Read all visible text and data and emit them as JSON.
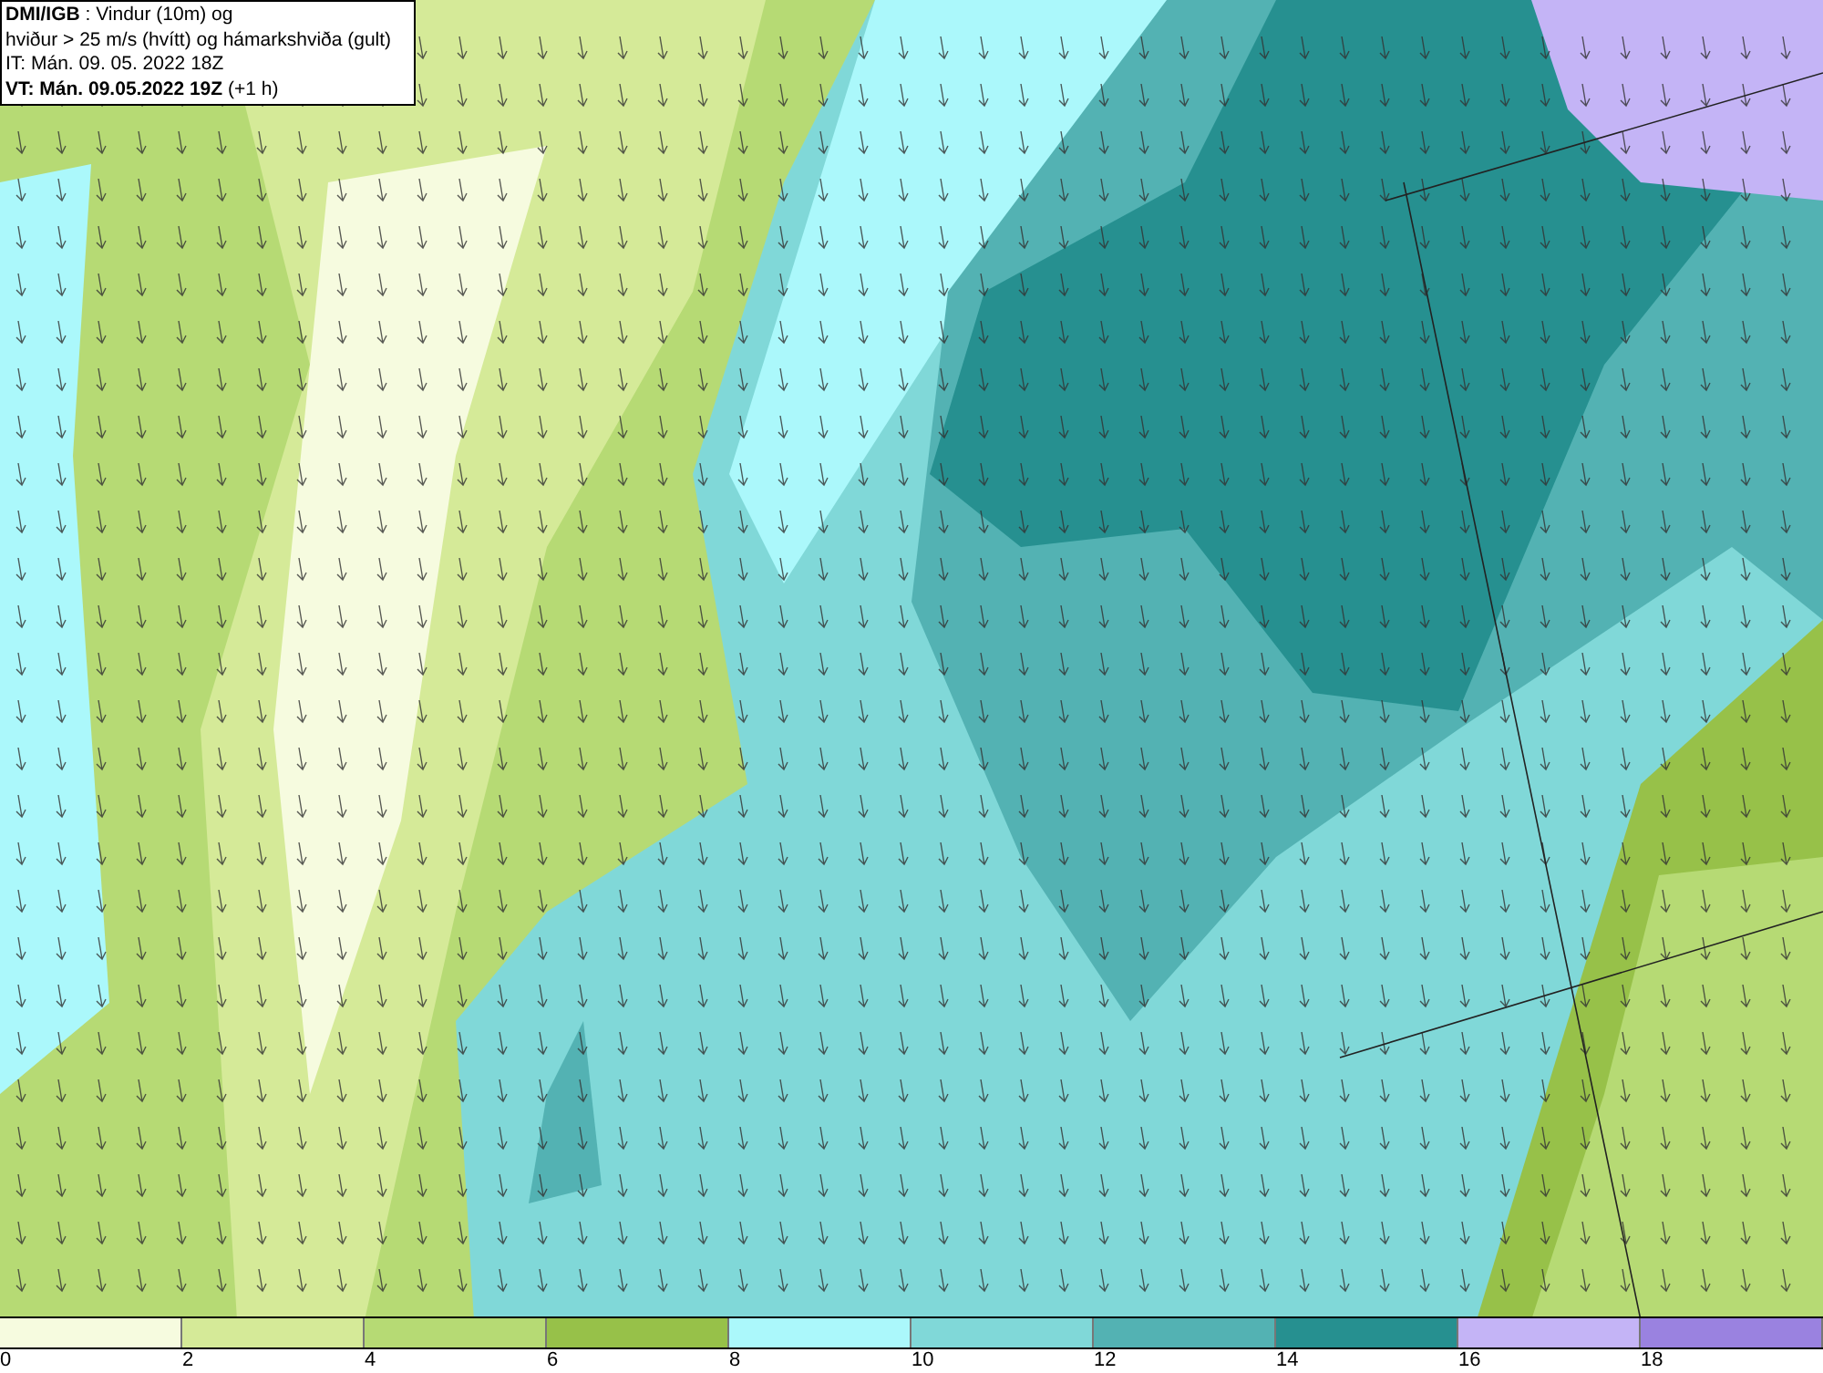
{
  "info_box": {
    "lines": [
      "**DMI/IGB** : Vindur (10m) og",
      "hviður > 25 m/s (hvítt) og hámarkshviða (gult)",
      "IT: Mán. 09. 05. 2022 18Z",
      "**VT: Mán. 09.05.2022 19Z** (+1 h)"
    ]
  },
  "legend": {
    "bins": [
      {
        "color": "#f6fbdf",
        "label": "0"
      },
      {
        "color": "#d5ea98",
        "label": "2"
      },
      {
        "color": "#b6da74",
        "label": "4"
      },
      {
        "color": "#97c149",
        "label": "6"
      },
      {
        "color": "#abf8fb",
        "label": "8"
      },
      {
        "color": "#80d8d8",
        "label": "10"
      },
      {
        "color": "#53b2b3",
        "label": "12"
      },
      {
        "color": "#269090",
        "label": "14"
      },
      {
        "color": "#c4b4f6",
        "label": "16"
      },
      {
        "color": "#9a82e0",
        "label": "18"
      }
    ]
  }
}
